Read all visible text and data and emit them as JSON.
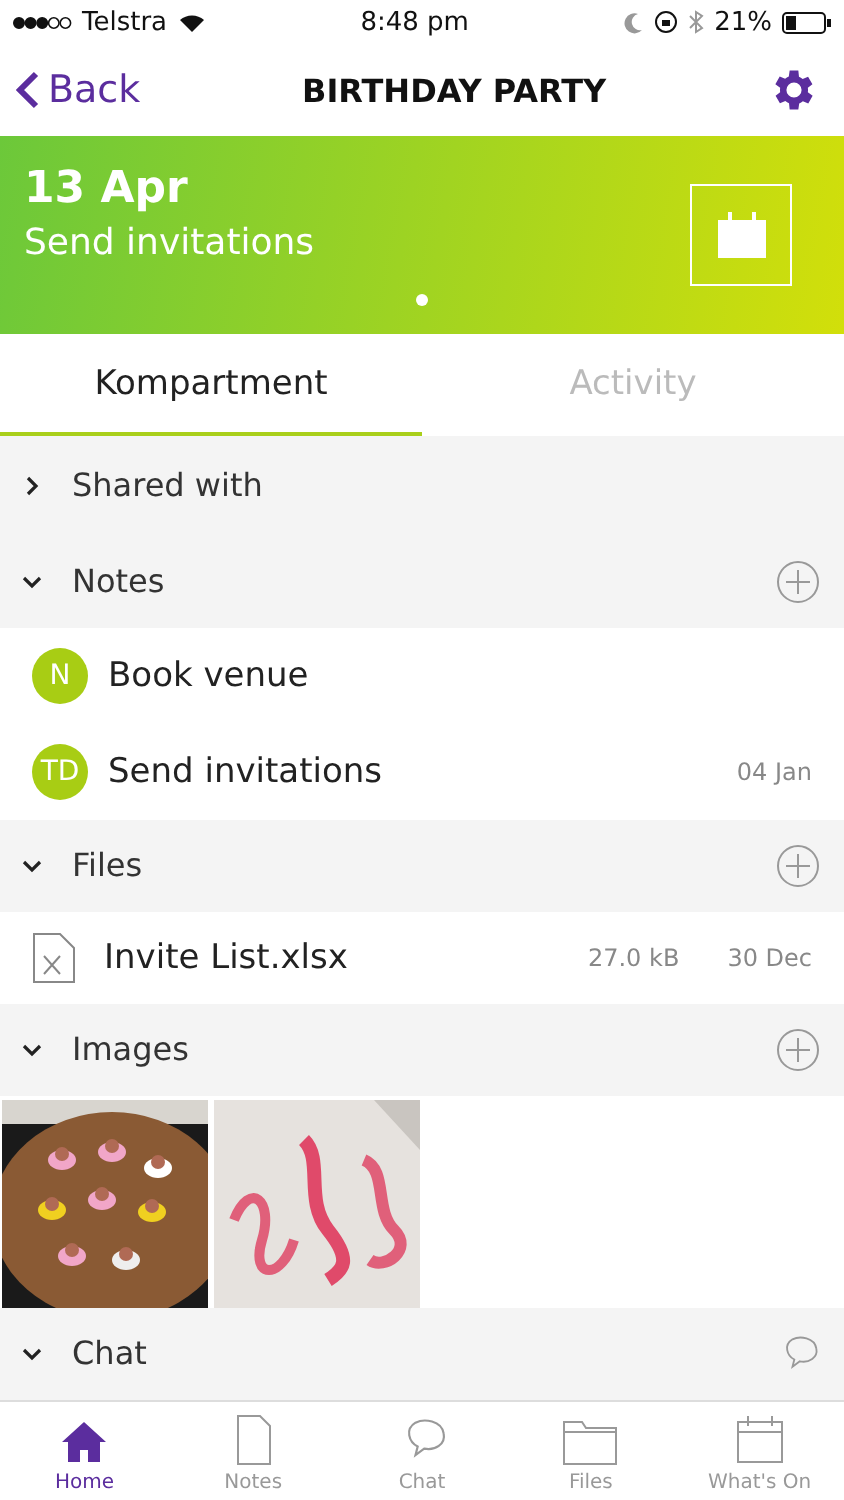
{
  "status_bar": {
    "carrier": "Telstra",
    "time": "8:48 pm",
    "battery": "21%"
  },
  "nav": {
    "back": "Back",
    "title": "BIRTHDAY PARTY"
  },
  "banner": {
    "date": "13 Apr",
    "subtitle": "Send invitations"
  },
  "tabs": [
    {
      "label": "Kompartment",
      "selected": true
    },
    {
      "label": "Activity",
      "selected": false
    }
  ],
  "sections": [
    {
      "title": "Shared with",
      "expanded": false,
      "addable": false,
      "kind": "people"
    },
    {
      "title": "Notes",
      "expanded": true,
      "addable": true,
      "kind": "notes",
      "notes": [
        {
          "initials": "N",
          "title": "Book venue"
        },
        {
          "initials": "TD",
          "title": "Send invitations",
          "date": "04 Jan"
        }
      ]
    },
    {
      "title": "Files",
      "expanded": true,
      "addable": true,
      "kind": "files",
      "files": [
        {
          "name": "Invite List.xlsx",
          "size": "27.0 kB",
          "date": "30 Dec"
        }
      ]
    },
    {
      "title": "Images",
      "expanded": true,
      "addable": true,
      "kind": "images"
    },
    {
      "title": "Chat",
      "expanded": true,
      "addable": false,
      "kind": "chat"
    }
  ],
  "tab_bar": [
    {
      "label": "Home",
      "selected": true
    },
    {
      "label": "Notes",
      "selected": false
    },
    {
      "label": "Chat",
      "selected": false
    },
    {
      "label": "Files",
      "selected": false
    },
    {
      "label": "What's On",
      "selected": false
    }
  ]
}
